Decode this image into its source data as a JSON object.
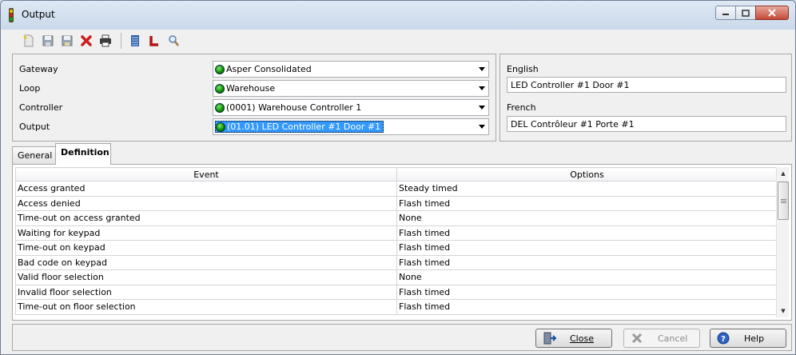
{
  "window": {
    "title": "Output"
  },
  "selectors": {
    "gateway": {
      "label": "Gateway",
      "value": "Asper Consolidated"
    },
    "loop": {
      "label": "Loop",
      "value": "Warehouse"
    },
    "controller": {
      "label": "Controller",
      "value": "(0001) Warehouse Controller 1"
    },
    "output": {
      "label": "Output",
      "value": "(01.01) LED Controller #1 Door #1"
    }
  },
  "languages": {
    "english": {
      "label": "English",
      "value": "LED Controller #1 Door #1"
    },
    "french": {
      "label": "French",
      "value": "DEL Contrôleur #1 Porte #1"
    }
  },
  "tabs": [
    {
      "label": "General"
    },
    {
      "label": "Definition",
      "active": true
    }
  ],
  "grid": {
    "columns": [
      "Event",
      "Options"
    ],
    "rows": [
      [
        "Access granted",
        "Steady timed"
      ],
      [
        "Access denied",
        "Flash timed"
      ],
      [
        "Time-out on access granted",
        "None"
      ],
      [
        "Waiting for keypad",
        "Flash timed"
      ],
      [
        "Time-out on keypad",
        "Flash timed"
      ],
      [
        "Bad code on keypad",
        "Flash timed"
      ],
      [
        "Valid floor selection",
        "None"
      ],
      [
        "Invalid floor selection",
        "Flash timed"
      ],
      [
        "Time-out on floor selection",
        "Flash timed"
      ]
    ]
  },
  "footer": {
    "close": "Close",
    "cancel": "Cancel",
    "help": "Help"
  },
  "colors": {
    "accent": "#3399ff",
    "led": "#0a8a00",
    "delete": "#cc1f1f"
  }
}
